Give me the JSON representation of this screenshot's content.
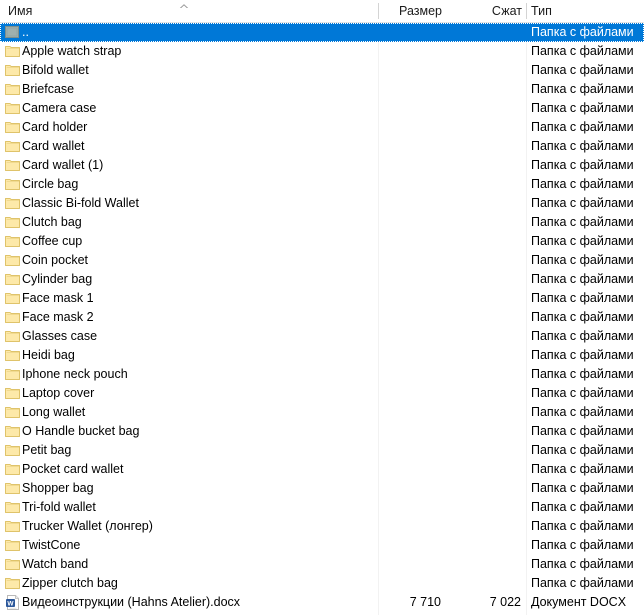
{
  "pane": {
    "title": "file-list-detail-view"
  },
  "columns": {
    "name": "Имя",
    "size": "Размер",
    "packed": "Сжат",
    "type": "Тип",
    "sort_indicator": "chevron-up-icon",
    "sorted_by": "Имя",
    "sort_direction": "ascending"
  },
  "types": {
    "folder": "Папка с файлами",
    "docx": "Документ DOCX"
  },
  "colors": {
    "selection": "#0078d7",
    "selection_text": "#ffffff",
    "folder_fill": "#fde9a9",
    "folder_outline": "#dfc36a",
    "parent_folder_fill": "#9fb0ae",
    "docx_blue": "#2b579a",
    "header_divider": "#d4d4d4",
    "text": "#000000"
  },
  "rows": [
    {
      "name": "..",
      "size": "",
      "packed": "",
      "type": "Папка с файлами",
      "icon": "parent-folder-icon",
      "selected": true
    },
    {
      "name": "Apple watch strap",
      "size": "",
      "packed": "",
      "type": "Папка с файлами",
      "icon": "folder-icon",
      "selected": false
    },
    {
      "name": "Bifold wallet",
      "size": "",
      "packed": "",
      "type": "Папка с файлами",
      "icon": "folder-icon",
      "selected": false
    },
    {
      "name": "Briefcase",
      "size": "",
      "packed": "",
      "type": "Папка с файлами",
      "icon": "folder-icon",
      "selected": false
    },
    {
      "name": "Camera case",
      "size": "",
      "packed": "",
      "type": "Папка с файлами",
      "icon": "folder-icon",
      "selected": false
    },
    {
      "name": "Card holder",
      "size": "",
      "packed": "",
      "type": "Папка с файлами",
      "icon": "folder-icon",
      "selected": false
    },
    {
      "name": "Card wallet",
      "size": "",
      "packed": "",
      "type": "Папка с файлами",
      "icon": "folder-icon",
      "selected": false
    },
    {
      "name": "Card wallet (1)",
      "size": "",
      "packed": "",
      "type": "Папка с файлами",
      "icon": "folder-icon",
      "selected": false
    },
    {
      "name": "Circle bag",
      "size": "",
      "packed": "",
      "type": "Папка с файлами",
      "icon": "folder-icon",
      "selected": false
    },
    {
      "name": "Classic Bi-fold Wallet",
      "size": "",
      "packed": "",
      "type": "Папка с файлами",
      "icon": "folder-icon",
      "selected": false
    },
    {
      "name": "Clutch bag",
      "size": "",
      "packed": "",
      "type": "Папка с файлами",
      "icon": "folder-icon",
      "selected": false
    },
    {
      "name": "Coffee cup",
      "size": "",
      "packed": "",
      "type": "Папка с файлами",
      "icon": "folder-icon",
      "selected": false
    },
    {
      "name": "Coin pocket",
      "size": "",
      "packed": "",
      "type": "Папка с файлами",
      "icon": "folder-icon",
      "selected": false
    },
    {
      "name": "Cylinder bag",
      "size": "",
      "packed": "",
      "type": "Папка с файлами",
      "icon": "folder-icon",
      "selected": false
    },
    {
      "name": "Face mask 1",
      "size": "",
      "packed": "",
      "type": "Папка с файлами",
      "icon": "folder-icon",
      "selected": false
    },
    {
      "name": "Face mask 2",
      "size": "",
      "packed": "",
      "type": "Папка с файлами",
      "icon": "folder-icon",
      "selected": false
    },
    {
      "name": "Glasses case",
      "size": "",
      "packed": "",
      "type": "Папка с файлами",
      "icon": "folder-icon",
      "selected": false
    },
    {
      "name": "Heidi bag",
      "size": "",
      "packed": "",
      "type": "Папка с файлами",
      "icon": "folder-icon",
      "selected": false
    },
    {
      "name": "Iphone neck pouch",
      "size": "",
      "packed": "",
      "type": "Папка с файлами",
      "icon": "folder-icon",
      "selected": false
    },
    {
      "name": "Laptop cover",
      "size": "",
      "packed": "",
      "type": "Папка с файлами",
      "icon": "folder-icon",
      "selected": false
    },
    {
      "name": "Long wallet",
      "size": "",
      "packed": "",
      "type": "Папка с файлами",
      "icon": "folder-icon",
      "selected": false
    },
    {
      "name": "O Handle bucket bag",
      "size": "",
      "packed": "",
      "type": "Папка с файлами",
      "icon": "folder-icon",
      "selected": false
    },
    {
      "name": "Petit bag",
      "size": "",
      "packed": "",
      "type": "Папка с файлами",
      "icon": "folder-icon",
      "selected": false
    },
    {
      "name": "Pocket card wallet",
      "size": "",
      "packed": "",
      "type": "Папка с файлами",
      "icon": "folder-icon",
      "selected": false
    },
    {
      "name": "Shopper bag",
      "size": "",
      "packed": "",
      "type": "Папка с файлами",
      "icon": "folder-icon",
      "selected": false
    },
    {
      "name": "Tri-fold wallet",
      "size": "",
      "packed": "",
      "type": "Папка с файлами",
      "icon": "folder-icon",
      "selected": false
    },
    {
      "name": "Trucker Wallet (лонгер)",
      "size": "",
      "packed": "",
      "type": "Папка с файлами",
      "icon": "folder-icon",
      "selected": false
    },
    {
      "name": "TwistCone",
      "size": "",
      "packed": "",
      "type": "Папка с файлами",
      "icon": "folder-icon",
      "selected": false
    },
    {
      "name": "Watch band",
      "size": "",
      "packed": "",
      "type": "Папка с файлами",
      "icon": "folder-icon",
      "selected": false
    },
    {
      "name": "Zipper clutch bag",
      "size": "",
      "packed": "",
      "type": "Папка с файлами",
      "icon": "folder-icon",
      "selected": false
    },
    {
      "name": "Видеоинструкции (Hahns Atelier).docx",
      "size": "7 710",
      "packed": "7 022",
      "type": "Документ DOCX",
      "icon": "docx-file-icon",
      "selected": false
    }
  ]
}
